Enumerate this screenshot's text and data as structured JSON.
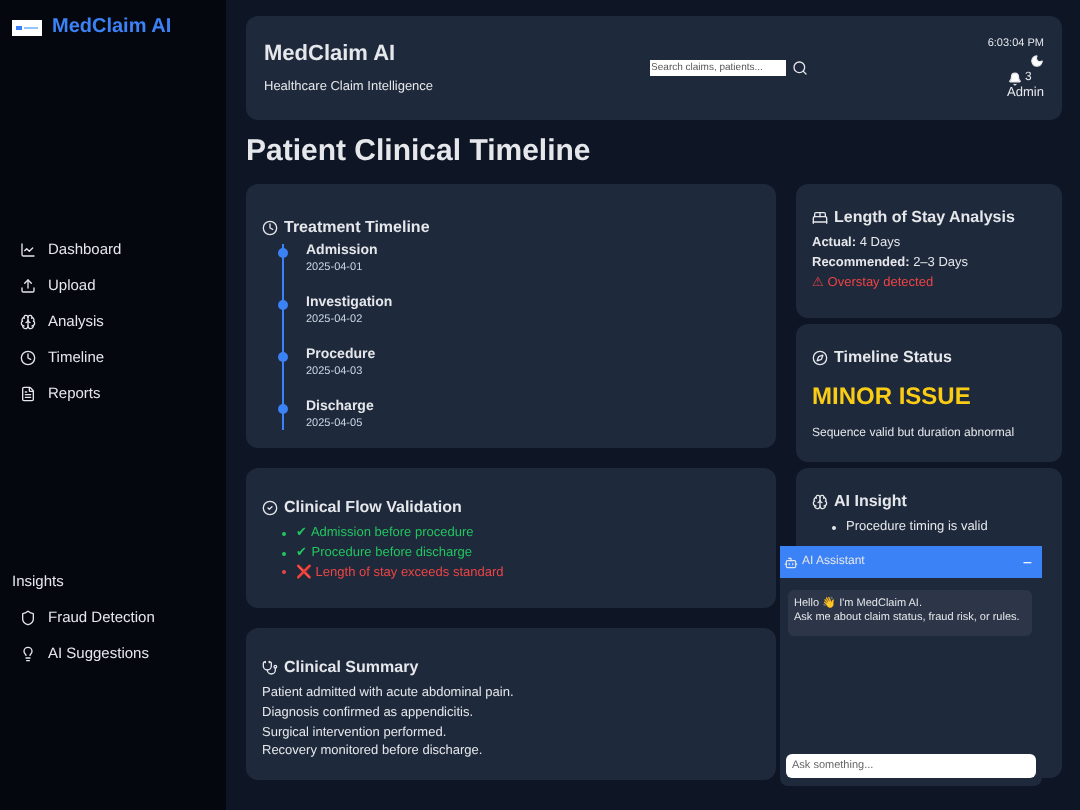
{
  "sidebar": {
    "brand": "MedClaim AI",
    "items": [
      {
        "label": "Dashboard",
        "selected": false
      },
      {
        "label": "Upload",
        "selected": false
      },
      {
        "label": "Analysis",
        "selected": false
      },
      {
        "label": "Timeline",
        "selected": false
      },
      {
        "label": "Reports",
        "selected": false
      }
    ],
    "section_title": "Insights",
    "insight_items": [
      {
        "label": "Fraud Detection",
        "selected": false
      },
      {
        "label": "AI Suggestions",
        "selected": false
      }
    ]
  },
  "header": {
    "title": "MedClaim AI",
    "subtitle": "Healthcare Claim Intelligence",
    "search": {
      "placeholder": "Search claims, patients..."
    },
    "time": "6:03:04 PM",
    "notifications": "3",
    "user": "Admin"
  },
  "page_title": "Patient Clinical Timeline",
  "timeline": {
    "title": "Treatment Timeline",
    "events": [
      {
        "name": "Admission",
        "date": "2025-04-01"
      },
      {
        "name": "Investigation",
        "date": "2025-04-02"
      },
      {
        "name": "Procedure",
        "date": "2025-04-03"
      },
      {
        "name": "Discharge",
        "date": "2025-04-05"
      }
    ]
  },
  "stay": {
    "title": "Length of Stay Analysis",
    "lines": [
      "**Actual:** 4 Days",
      "**Recommended:** 2–3 Days"
    ],
    "warning": "⚠ Overstay detected"
  },
  "status": {
    "title": "Timeline Status",
    "value": "MINOR ISSUE",
    "color": "#facc15",
    "note": "Sequence valid but duration abnormal"
  },
  "flow": {
    "title": "Clinical Flow Validation",
    "checks": [
      {
        "text": "✔ Admission before procedure",
        "color": "#22c55e"
      },
      {
        "text": "✔ Procedure before discharge",
        "color": "#22c55e"
      },
      {
        "text": "❌ Length of stay exceeds standard",
        "color": "#ef4444"
      }
    ]
  },
  "insight": {
    "title": "AI Insight",
    "points": [
      "Procedure timing is valid"
    ]
  },
  "summary": {
    "title": "Clinical Summary",
    "lines": [
      "Patient admitted with acute abdominal pain.",
      "Diagnosis confirmed as appendicitis.",
      "Surgical intervention performed.",
      "Recovery monitored before discharge."
    ]
  },
  "chat": {
    "title": "AI Assistant",
    "minimize": "−",
    "message": "Hello 👋 I'm MedClaim AI.\nAsk me about claim status, fraud risk, or rules.",
    "input": {
      "placeholder": "Ask something..."
    }
  }
}
